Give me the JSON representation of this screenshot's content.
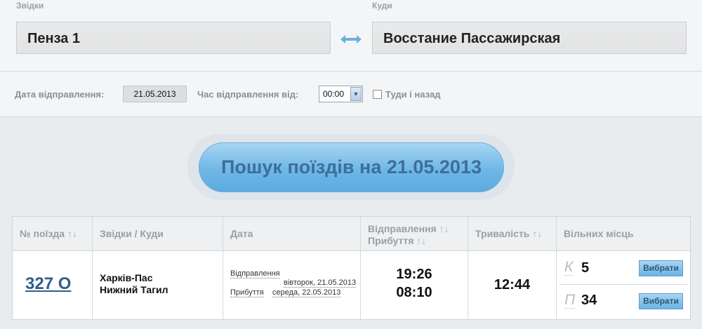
{
  "route": {
    "from_label": "Звідки",
    "to_label": "Куди",
    "from_value": "Пенза 1",
    "to_value": "Восстание Пассажирская",
    "swap_icon": "swap-arrows-icon"
  },
  "params": {
    "date_label": "Дата відправлення:",
    "date_value": "21.05.2013",
    "time_label": "Час відправлення від:",
    "time_value": "00:00",
    "roundtrip_label": "Туди і назад",
    "roundtrip_checked": false
  },
  "search": {
    "button_label": "Пошук поїздів на 21.05.2013"
  },
  "table": {
    "headers": {
      "train_no": "№ поїзда",
      "from_to": "Звідки / Куди",
      "date": "Дата",
      "departure": "Відправлення",
      "arrival": "Прибуття",
      "duration": "Тривалість",
      "seats": "Вільних місць",
      "sort_glyph": "↑↓"
    },
    "rows": [
      {
        "train_no": "327 О",
        "from": "Харків-Пас",
        "to": "Нижний Тагил",
        "departure_label": "Відправлення",
        "departure_date": "вівторок, 21.05.2013",
        "arrival_label": "Прибуття",
        "arrival_date": "середа, 22.05.2013",
        "departure_time": "19:26",
        "arrival_time": "08:10",
        "duration": "12:44",
        "seats": [
          {
            "class": "К",
            "count": "5",
            "button": "Вибрати"
          },
          {
            "class": "П",
            "count": "34",
            "button": "Вибрати"
          }
        ]
      }
    ]
  },
  "colors": {
    "accent": "#6fb7e6",
    "link": "#2f5f8a"
  }
}
